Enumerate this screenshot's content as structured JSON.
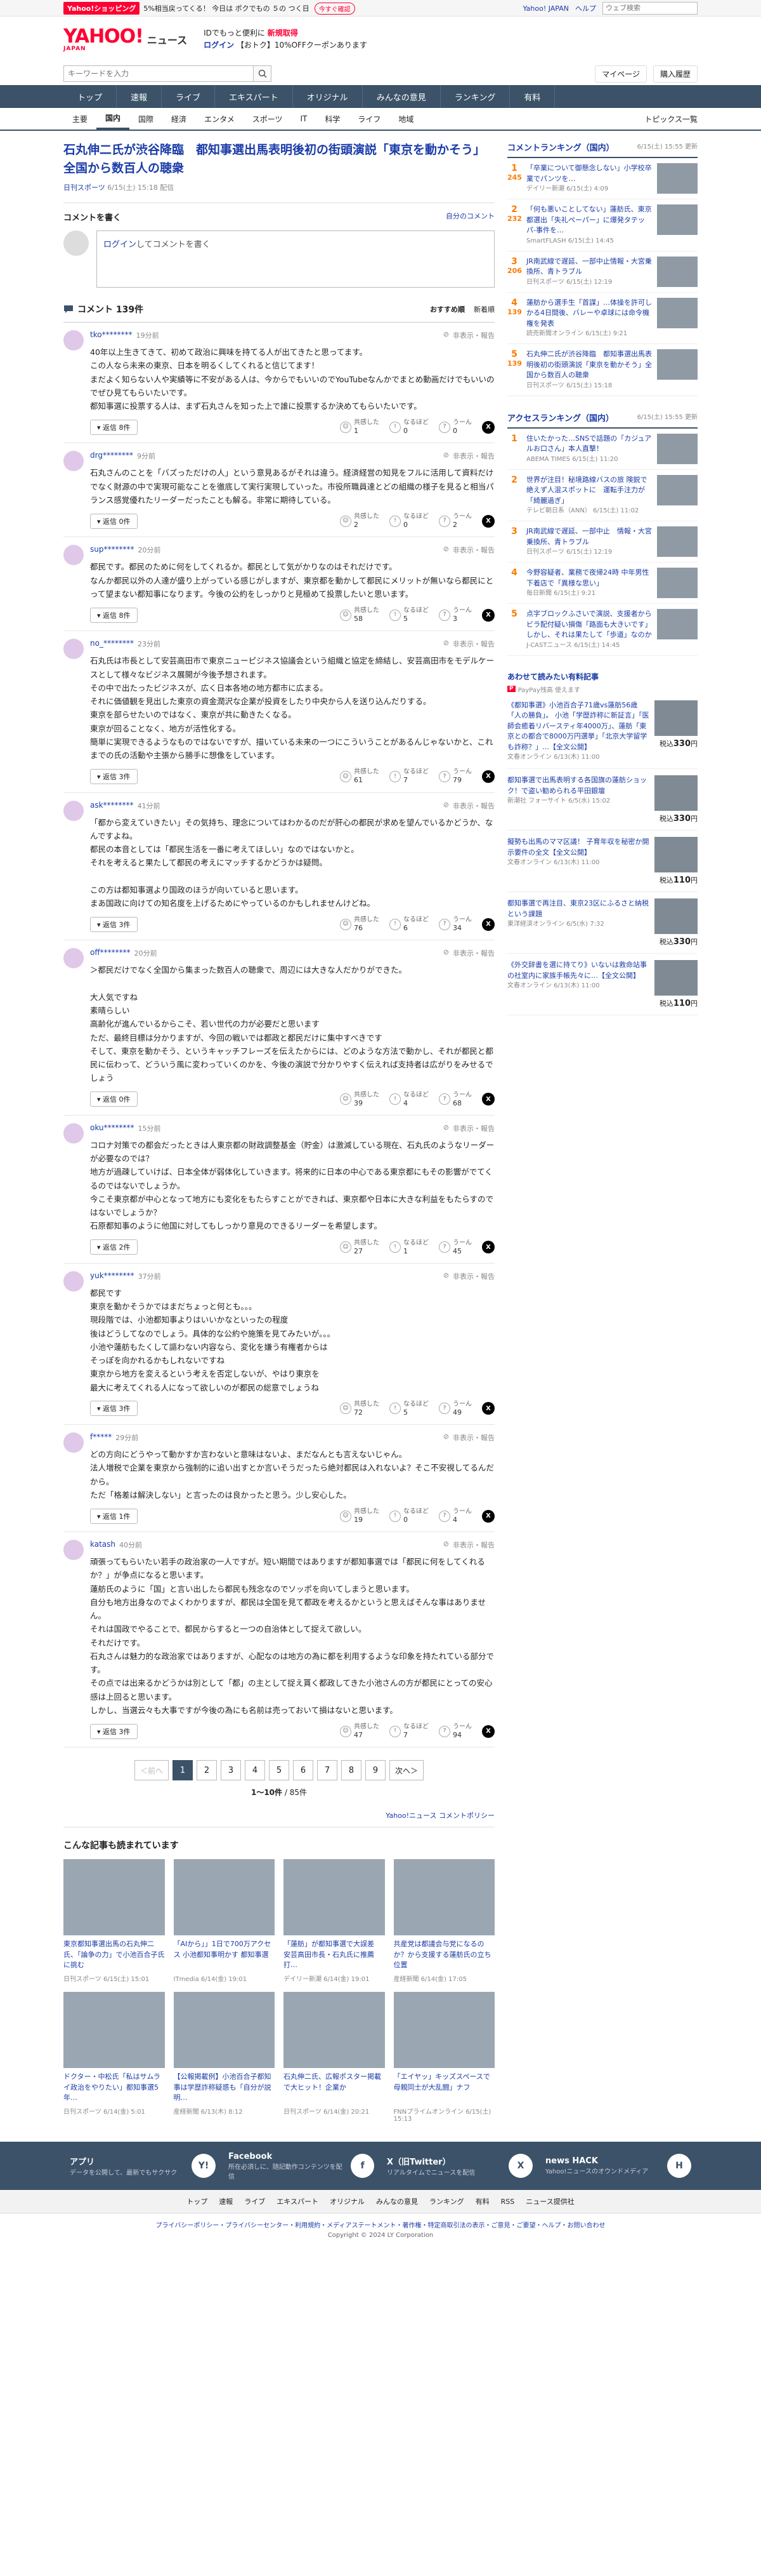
{
  "promo": {
    "tag": "Yahoo!ショッピング",
    "text": "5%相当戻ってくる！ 今日は ポクでもの ５の つく日",
    "button": "今すぐ確認",
    "links": [
      "Yahoo! JAPAN",
      "ヘルプ"
    ],
    "search_placeholder": "ウェブ検索"
  },
  "header": {
    "logo": "YAHOO!",
    "logo_sub_small": "JAPAN",
    "section": "ニュース",
    "promo_line1_prefix": "IDでもっと便利に",
    "promo_line1_link": "新規取得",
    "promo_line2_link": "ログイン",
    "promo_line2_text": "【おトク】10%OFFクーポンあります"
  },
  "search": {
    "placeholder": "キーワードを入力",
    "mypage": "マイページ",
    "history": "購入履歴"
  },
  "nav": [
    "トップ",
    "速報",
    "ライブ",
    "エキスパート",
    "オリジナル",
    "みんなの意見",
    "ランキング",
    "有料"
  ],
  "subnav": [
    "主要",
    "国内",
    "国際",
    "経済",
    "エンタメ",
    "スポーツ",
    "IT",
    "科学",
    "ライフ",
    "地域"
  ],
  "subnav_topics": "トピックス一覧",
  "article": {
    "title": "石丸伸二氏が渋谷降臨　都知事選出馬表明後初の街頭演説「東京を動かそう」全国から数百人の聴衆",
    "source": "日刊スポーツ",
    "date": "6/15(土) 15:18 配信"
  },
  "comment_form": {
    "heading": "コメントを書く",
    "policy": "自分のコメント",
    "login": "ログイン",
    "prompt": "してコメントを書く"
  },
  "comments_header": {
    "title": "コメント 139件",
    "sort_recommended": "おすすめ順",
    "sort_new": "新着順"
  },
  "comment_labels": {
    "report": "非表示・報告",
    "empathy": "共感した",
    "insight": "なるほど",
    "hmm": "うーん",
    "reply": "返信"
  },
  "comments": [
    {
      "user": "tko********",
      "time": "19分前",
      "text": "40年以上生きてきて、初めて政治に興味を持てる人が出てきたと思ってます。\nこの人なら未来の東京、日本を明るくしてくれると信じてます！\nまだよく知らない人や実績等に不安がある人は、今からでもいいのでYouTubeなんかでまとめ動画だけでもいいのでぜひ見てもらいたいです。\n都知事選に投票する人は、まず石丸さんを知った上で誰に投票するか決めてもらいたいです。",
      "replies": "返信 8件",
      "empathy": 1,
      "insight": 0,
      "hmm": 0
    },
    {
      "user": "drg********",
      "time": "9分前",
      "text": "石丸さんのことを「バズっただけの人」という意見あるがそれは違う。経済経営の知見をフルに活用して資料だけでなく財源の中で実現可能なことを徹底して実行実現していった。市役所職員達とどの組織の様子を見ると相当パランス感覚優れたリーダーだったことも解る。非常に期待している。",
      "replies": "返信 0件",
      "empathy": 2,
      "insight": 0,
      "hmm": 2
    },
    {
      "user": "sup********",
      "time": "20分前",
      "text": "都民です。都民のために何をしてくれるか。都民として気がかりなのはそれだけです。\nなんか都民以外の人達が盛り上がっている感じがしますが、東京都を動かして都民にメリットが無いなら都民にとって望まない都知事になります。今後の公約をしっかりと見極めて投票したいと思います。",
      "replies": "返信 8件",
      "empathy": 58,
      "insight": 5,
      "hmm": 3
    },
    {
      "user": "no_********",
      "time": "23分前",
      "text": "石丸氏は市長として安芸高田市で東京ニューピジネス協議会という組織と協定を締結し、安芸高田市をモデルケースとして様々なビジネス展開が今後予想されます。\nその中で出たったビジネスが、広く日本各地の地方都市に広まる。\nそれに価値観を見出した東京の資金潤沢な企業が投資をしたり中央から人を送り込んだりする。\n東京を部らせたいのではなく、東京が共に動きたくなる。\n東京が回ることなく、地方が活性化する。\n簡単に実現できるようなものではないですが、描いている未来の一つにこういうことがあるんじゃないかと、これまでの氏の活動や主張から勝手に想像をしています。",
      "replies": "返信 3件",
      "empathy": 61,
      "insight": 7,
      "hmm": 79
    },
    {
      "user": "ask********",
      "time": "41分前",
      "text": "「都から変えていきたい」その気持ち、理念についてはわかるのだが肝心の都民が求めを望んでいるかどうか、なんですよね。\n都民の本音としては「都民生活を一番に考えてほしい」なのではないかと。\nそれを考えると果たして都民の考えにマッチするかどうかは疑問。\n\nこの方は都知事選より国政のほうが向いていると思います。\nまあ国政に向けての知名度を上げるためにやっているのかもしれませんけどね。",
      "replies": "返信 3件",
      "empathy": 76,
      "insight": 6,
      "hmm": 34
    },
    {
      "user": "off********",
      "time": "20分前",
      "text": "＞都民だけでなく全国から集まった数百人の聴衆で、周辺には大きな人だかりができた。\n\n大人気ですね\n素晴らしい\n高齢化が進んでいるからこそ、若い世代の力が必要だと思います\nただ、最終目標は分かりますが、今回の戦いでは都政と都民だけに集中すべきです\nそして、東京を動かそう、というキャッチフレーズを伝えたからには、どのような方法で動かし、それが都民と都民に伝わって、どういう風に変わっていくのかを、今後の演説で分かりやすく伝えれば支持者は広がりをみせるでしょう",
      "replies": "返信 0件",
      "empathy": 39,
      "insight": 4,
      "hmm": 68
    },
    {
      "user": "oku********",
      "time": "15分前",
      "text": "コロナ対策での都会だったときは人東京都の財政調整基金（貯金）は激減している現在、石丸氏のようなリーダーが必要なのでは？\n地方が過疎していけば、日本全体が弱体化していきます。将来的に日本の中心である東京都にもその影響がでてくるのではないでしょうか。\n今こそ東京都が中心となって地方にも変化をもたらすことができれば、東京都や日本に大きな利益をもたらすのではないでしょうか？\n石原都知事のように他国に対してもしっかり意見のできるリーダーを希望します。",
      "replies": "返信 2件",
      "empathy": 27,
      "insight": 1,
      "hmm": 45
    },
    {
      "user": "yuk********",
      "time": "37分前",
      "text": "都民です\n東京を動かそうかではまだちょっと何とも。。。\n現段階では、小池都知事よりはいいかなといったの程度\n後はどうしてなのでしょう。具体的な公約や施策を見てみたいが。。。\n小池や蓮舫もたくして謳わない内容なら、変化を嫌う有権者からは\nそっぽを向かれるかもしれないですね\n東京から地方を変えるという考えを否定しないが、やはり東京を\n最大に考えてくれる人になって欲しいのが都民の総意でしょうね",
      "replies": "返信 3件",
      "empathy": 72,
      "insight": 5,
      "hmm": 49
    },
    {
      "user": "f*****",
      "time": "29分前",
      "text": "どの方向にどうやって動かすか言わないと意味はないよ、まだなんとも言えないじゃん。\n法人増税で企業を東京から強制的に追い出すとか言いそうだったら絶対都民は入れないよ？そこ不安視してるんだから。\nただ「格差は解決しない」と言ったのは良かったと思う。少し安心した。",
      "replies": "返信 1件",
      "empathy": 19,
      "insight": 0,
      "hmm": 4
    },
    {
      "user": "katash",
      "time": "40分前",
      "text": "頑張ってもらいたい若手の政治家の一人ですが。短い期間ではありますが都知事選では「都民に何をしてくれるか？」が争点になると思います。\n蓮舫氏のように「国」と言い出したら都民も残念なのでソッポを向いてしまうと思います。\n自分も地方出身なのでよくわかりますが、都民は全国を見て都政を考えるかというと思えばそんな事はありません。\nそれは国政でやることで、都民からすると一つの自治体として捉えて欲しい。\nそれだけです。\n石丸さんは魅力的な政治家ではありますが、心配なのは地方の為に都を利用するような印象を持たれている部分です。\nその点では出来るかどうかは別として「都」の主として捉え貰く都政してきた小池さんの方が都民にとっての安心感は上回ると思います。\nしかし、当選云々も大事ですが今後の為にも名前は売っておいて損はないと思います。",
      "replies": "返信 3件",
      "empathy": 47,
      "insight": 7,
      "hmm": 94
    }
  ],
  "pager": {
    "prev": "＜前へ",
    "pages": [
      "1",
      "2",
      "3",
      "4",
      "5",
      "6",
      "7",
      "8",
      "9"
    ],
    "next": "次へ＞",
    "range": "1〜10件",
    "total": "85件"
  },
  "comment_link": "Yahoo!ニュース コメントポリシー",
  "recommend": {
    "title": "こんな記事も読まれています",
    "items": [
      {
        "title": "東京都知事選出馬の石丸伸二氏、「論争の力」で小池百合子氏に挑む",
        "meta": "日刊スポーツ 6/15(土) 15:01"
      },
      {
        "title": "「AIから」」1日で700万アクセス 小池都知事明かす 都知事選",
        "meta": "ITmedia 6/14(金) 19:01"
      },
      {
        "title": "「蓮舫」が都知事選で大誤差　安芸高田市長・石丸氏に推薦打…",
        "meta": "デイリー新潮 6/14(金) 19:01"
      },
      {
        "title": "共産党は都議会与党になるのか？から支援する蓮舫氏の立ち位置",
        "meta": "産経新聞 6/14(金) 17:05"
      },
      {
        "title": "ドクター・中松氏「私はサムライ政治をやりたい」都知事選5年…",
        "meta": "日刊スポーツ 6/14(金) 5:01"
      },
      {
        "title": "【公報掲載例】小池百合子都知事は学歴詐称疑惑も「自分が説明…",
        "meta": "産経新聞 6/13(木) 8:12"
      },
      {
        "title": "石丸伸二氏、広報ポスター掲載で大ヒット！企業か",
        "meta": "日刊スポーツ 6/14(金) 20:21"
      },
      {
        "title": "「エイヤッ」キッズスペースで母親同士が大乱闘」ナフ",
        "meta": "FNNプライムオンライン 6/15(土) 15:13"
      }
    ]
  },
  "ranking": {
    "title": "コメントランキング（国内）",
    "date": "6/15(土) 15:55 更新",
    "items": [
      {
        "num": "1",
        "cmt": "245",
        "text": "「卒業について御懸念しない」小学校卒業でパンツを…",
        "meta": "デイリー新潮 6/15(土) 4:09"
      },
      {
        "num": "2",
        "cmt": "232",
        "text": "「何も悪いことしてない」蓮舫氏、東京都選出「失礼ペーパー」に爆発タテッパ-事件を…",
        "meta": "SmartFLASH 6/15(土) 14:45"
      },
      {
        "num": "3",
        "cmt": "206",
        "text": "JR南武線で遅延、一部中止情報・大宮乗換所、青トラブル",
        "meta": "日刊スポーツ 6/15(土) 12:19"
      },
      {
        "num": "4",
        "cmt": "139",
        "text": "蓮舫から選手生「首謀」…体操を許可しかる4日間後、バレーや卓球には命令機権を発表",
        "meta": "読売新聞オンライン 6/15(土) 9:21"
      },
      {
        "num": "5",
        "cmt": "139",
        "text": "石丸伸二氏が渋谷降臨　都知事選出馬表明後初の街頭演説「東京を動かそう」全国から数百人の聴衆",
        "meta": "日刊スポーツ 6/15(土) 15:18"
      }
    ]
  },
  "access": {
    "title": "アクセスランキング（国内）",
    "date": "6/15(土) 15:55 更新",
    "items": [
      {
        "num": "1",
        "text": "住いたかった…SNSで話題の「カジュアルお口さん」本人直撃！",
        "meta": "ABEMA TIMES 6/15(土) 11:20"
      },
      {
        "num": "2",
        "text": "世界が注目！秘境路線バスの旅 険鋭で絶えず人混スポットに　運転手注力が「綺麗過ぎ」",
        "meta": "テレビ朝日系（ANN） 6/15(土) 11:02"
      },
      {
        "num": "3",
        "text": "JR南武線で遅延、一部中止　情報・大宮乗換所、青トラブル",
        "meta": "日刊スポーツ 6/15(土) 12:19"
      },
      {
        "num": "4",
        "text": "今野容疑者、業務で夜帰24時 中年男性下着店で「異様な思い」",
        "meta": "毎日新聞 6/15(土) 9:21"
      },
      {
        "num": "5",
        "text": "点字ブロックふさいで演説、支援者からビラ配付疑い損傷「路面も大きいです」しかし、それは果たして「歩道」なのか",
        "meta": "J-CASTニュース 6/15(土) 14:45"
      }
    ]
  },
  "ads": {
    "title": "あわせて読みたい有料記事",
    "sub": "PayPay残高 使えます",
    "items": [
      {
        "text": "《都知事選》小池百合子71歳vs蓮舫56歳「人の勝負」。 小池「学歴詐称に新証言」「医師会癒着リバースティ年4000万」、蓮舫「東京との都合で8000万円選挙」「北京大学留学も詐称？」…【全文公開】",
        "meta": "文春オンライン 6/13(木) 11:00",
        "price": "330"
      },
      {
        "text": "都知事選で出馬表明する各国旗の蓮舫ショック！で盗い勧められる平田銀壇",
        "meta": "新潮社 フォーサイト 6/5(水) 15:02",
        "price": "330"
      },
      {
        "text": "擬勢も出馬のママ区議！ 子育年収を秘密か開示要件の全文【全文公開】",
        "meta": "文春オンライン 6/13(木) 11:00",
        "price": "110"
      },
      {
        "text": "都知事選で再注目、東京23区にふるさと納税という課題",
        "meta": "東洋経済オンライン 6/5(水) 7:32",
        "price": "330"
      },
      {
        "text": "《外交辞書を選に持てり》いないは救命站事の社室内に家族手帳先々に…【全文公開】",
        "meta": "文春オンライン 6/13(木) 11:00",
        "price": "110"
      }
    ]
  },
  "footer_banner": [
    {
      "title": "アプリ",
      "sub": "データを公開して、最新でもサクサク",
      "badge": "Y!"
    },
    {
      "title": "Facebook",
      "sub": "所在必須しに、随記動作コンテンツを配信",
      "badge": "f"
    },
    {
      "title": "X（旧Twitter）",
      "sub": "リアルタイムでニュースを配信",
      "badge": "X"
    },
    {
      "title": "news HACK",
      "sub": "Yahoo!ニュースのオウンドメディア",
      "badge": "H"
    }
  ],
  "footer_nav": [
    "トップ",
    "速報",
    "ライブ",
    "エキスパート",
    "オリジナル",
    "みんなの意見",
    "ランキング",
    "有料",
    "RSS",
    "ニュース提供社"
  ],
  "footer_links": "プライバシーポリシー・プライバシーセンター・利用規約・メディアステートメント・著作権・特定商取引法の表示・ご意見・ご要望・ヘルプ・お問い合わせ",
  "copyright": "Copyright © 2024 LY Corporation"
}
